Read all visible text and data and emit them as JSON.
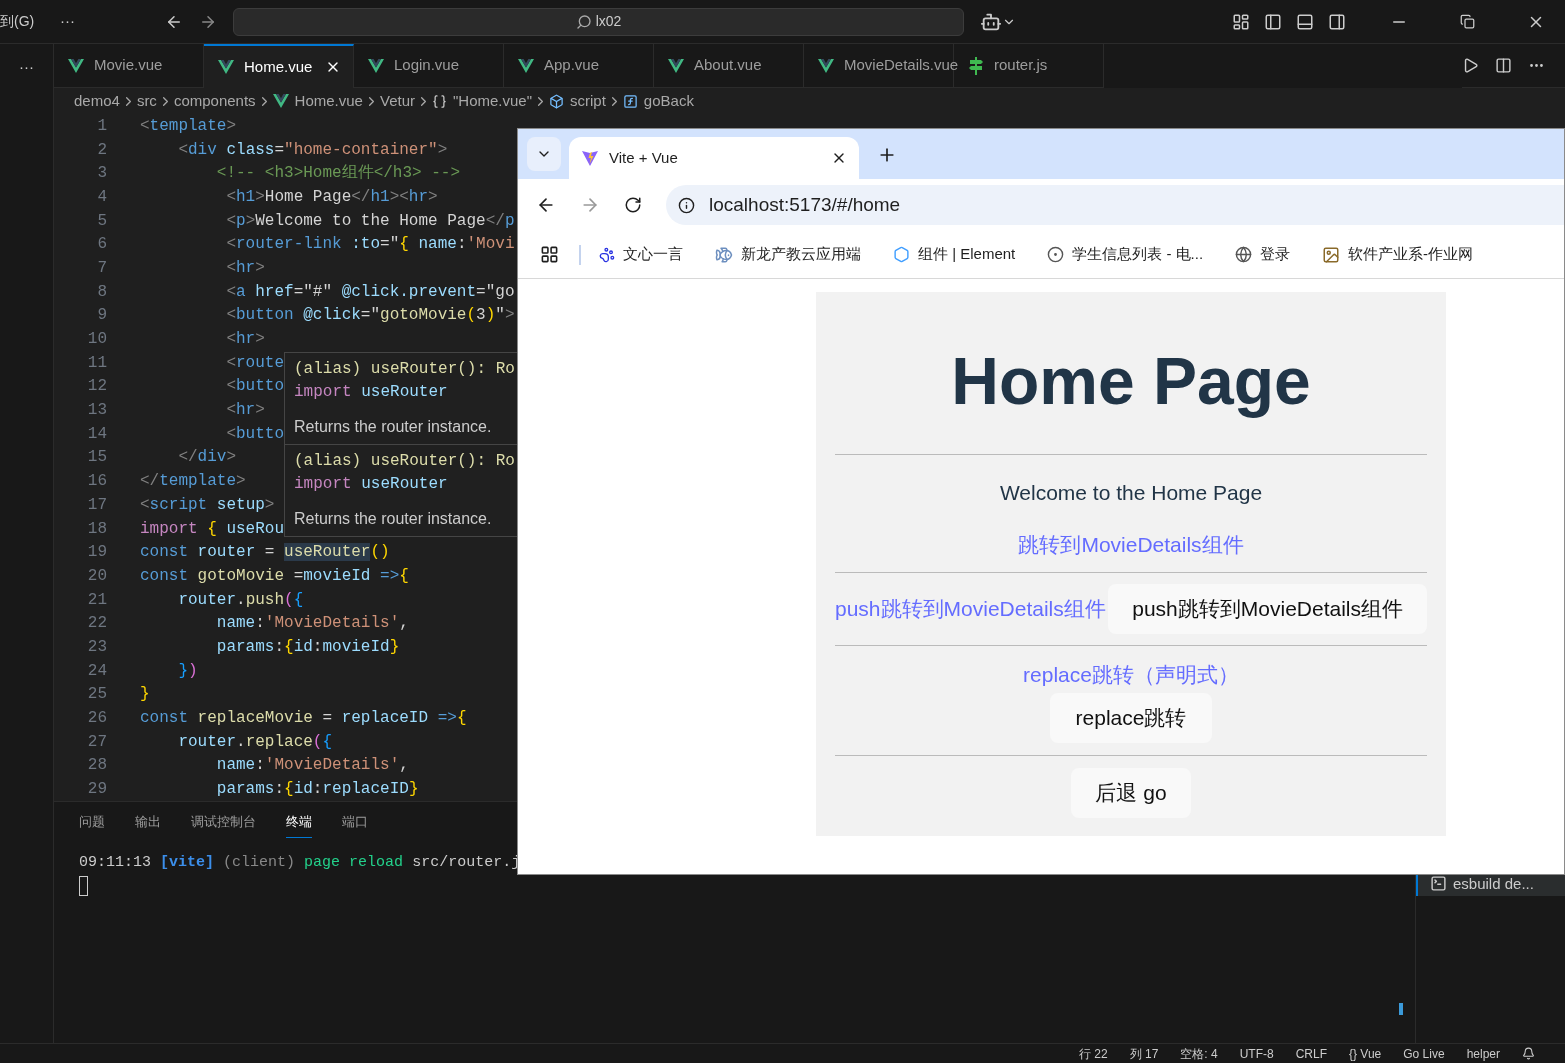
{
  "title_bar": {
    "menu_fragment": "到(G)",
    "more": "···",
    "search": "lx02"
  },
  "activity_bar": {
    "more": "···"
  },
  "tabs": [
    {
      "label": "Movie.vue",
      "kind": "vue",
      "selected": false
    },
    {
      "label": "Home.vue",
      "kind": "vue",
      "selected": true
    },
    {
      "label": "Login.vue",
      "kind": "vue",
      "selected": false
    },
    {
      "label": "App.vue",
      "kind": "vue",
      "selected": false
    },
    {
      "label": "About.vue",
      "kind": "vue",
      "selected": false
    },
    {
      "label": "MovieDetails.vue",
      "kind": "vue",
      "selected": false
    },
    {
      "label": "router.js",
      "kind": "js",
      "selected": false
    }
  ],
  "breadcrumb": [
    {
      "label": "demo4",
      "kind": "folder"
    },
    {
      "label": "src",
      "kind": "folder"
    },
    {
      "label": "components",
      "kind": "folder"
    },
    {
      "label": "Home.vue",
      "kind": "vue"
    },
    {
      "label": "Vetur",
      "kind": "folder"
    },
    {
      "label": "\"Home.vue\"",
      "kind": "braces"
    },
    {
      "label": "script",
      "kind": "module"
    },
    {
      "label": "goBack",
      "kind": "symbol"
    }
  ],
  "editor": {
    "lines": [
      {
        "number": "1",
        "tokens": [
          {
            "kind": "punct",
            "text": "<"
          },
          {
            "kind": "tag",
            "text": "template"
          },
          {
            "kind": "punct",
            "text": ">"
          }
        ]
      },
      {
        "number": "2",
        "tokens": [
          {
            "kind": "punct",
            "text": "    <"
          },
          {
            "kind": "tag",
            "text": "div"
          },
          {
            "kind": "attr",
            "text": " class"
          },
          {
            "kind": "text",
            "text": "="
          },
          {
            "kind": "string",
            "text": "\"home-container\""
          },
          {
            "kind": "punct",
            "text": ">"
          }
        ]
      },
      {
        "number": "3",
        "tokens": [
          {
            "kind": "comment",
            "text": "        <!-- <h3>Home组件</h3> -->"
          }
        ]
      },
      {
        "number": "4",
        "tokens": [
          {
            "kind": "punct",
            "text": "         <"
          },
          {
            "kind": "tag",
            "text": "h1"
          },
          {
            "kind": "punct",
            "text": ">"
          },
          {
            "kind": "text",
            "text": "Home Page"
          },
          {
            "kind": "punct",
            "text": "</"
          },
          {
            "kind": "tag",
            "text": "h1"
          },
          {
            "kind": "punct",
            "text": "><"
          },
          {
            "kind": "tag",
            "text": "hr"
          },
          {
            "kind": "punct",
            "text": ">"
          }
        ]
      },
      {
        "number": "5",
        "tokens": [
          {
            "kind": "punct",
            "text": "         <"
          },
          {
            "kind": "tag",
            "text": "p"
          },
          {
            "kind": "punct",
            "text": ">"
          },
          {
            "kind": "text",
            "text": "Welcome to the Home Page"
          },
          {
            "kind": "punct",
            "text": "</"
          },
          {
            "kind": "tag",
            "text": "p"
          }
        ]
      },
      {
        "number": "6",
        "tokens": [
          {
            "kind": "punct",
            "text": "         <"
          },
          {
            "kind": "tag",
            "text": "router-link"
          },
          {
            "kind": "attr",
            "text": " :to"
          },
          {
            "kind": "text",
            "text": "=\""
          },
          {
            "kind": "bracket1",
            "text": "{"
          },
          {
            "kind": "attr",
            "text": " name"
          },
          {
            "kind": "text",
            "text": ":"
          },
          {
            "kind": "string",
            "text": "'Movi"
          }
        ]
      },
      {
        "number": "7",
        "tokens": [
          {
            "kind": "punct",
            "text": "         <"
          },
          {
            "kind": "tag",
            "text": "hr"
          },
          {
            "kind": "punct",
            "text": ">"
          }
        ]
      },
      {
        "number": "8",
        "tokens": [
          {
            "kind": "punct",
            "text": "         <"
          },
          {
            "kind": "tag",
            "text": "a"
          },
          {
            "kind": "attr",
            "text": " href"
          },
          {
            "kind": "text",
            "text": "=\"#\""
          },
          {
            "kind": "attr",
            "text": " @click.prevent"
          },
          {
            "kind": "text",
            "text": "=\"go"
          }
        ]
      },
      {
        "number": "9",
        "tokens": [
          {
            "kind": "punct",
            "text": "         <"
          },
          {
            "kind": "tag",
            "text": "button"
          },
          {
            "kind": "attr",
            "text": " @click"
          },
          {
            "kind": "text",
            "text": "=\""
          },
          {
            "kind": "function",
            "text": "gotoMovie"
          },
          {
            "kind": "bracket1",
            "text": "("
          },
          {
            "kind": "text",
            "text": "3"
          },
          {
            "kind": "bracket1",
            "text": ")"
          },
          {
            "kind": "text",
            "text": "\""
          },
          {
            "kind": "punct",
            "text": ">"
          }
        ]
      },
      {
        "number": "10",
        "tokens": [
          {
            "kind": "punct",
            "text": "         <"
          },
          {
            "kind": "tag",
            "text": "hr"
          },
          {
            "kind": "punct",
            "text": ">"
          }
        ]
      },
      {
        "number": "11",
        "tokens": [
          {
            "kind": "punct",
            "text": "         <"
          },
          {
            "kind": "tag",
            "text": "route"
          }
        ]
      },
      {
        "number": "12",
        "tokens": [
          {
            "kind": "punct",
            "text": "         <"
          },
          {
            "kind": "tag",
            "text": "butto"
          }
        ]
      },
      {
        "number": "13",
        "tokens": [
          {
            "kind": "punct",
            "text": "         <"
          },
          {
            "kind": "tag",
            "text": "hr"
          },
          {
            "kind": "punct",
            "text": ">"
          }
        ]
      },
      {
        "number": "14",
        "tokens": [
          {
            "kind": "punct",
            "text": "         <"
          },
          {
            "kind": "tag",
            "text": "butto"
          }
        ]
      },
      {
        "number": "15",
        "tokens": [
          {
            "kind": "punct",
            "text": "    </"
          },
          {
            "kind": "tag",
            "text": "div"
          },
          {
            "kind": "punct",
            "text": ">"
          }
        ]
      },
      {
        "number": "16",
        "tokens": [
          {
            "kind": "punct",
            "text": "</"
          },
          {
            "kind": "tag",
            "text": "template"
          },
          {
            "kind": "punct",
            "text": ">"
          }
        ]
      },
      {
        "number": "17",
        "tokens": [
          {
            "kind": "punct",
            "text": "<"
          },
          {
            "kind": "tag",
            "text": "script"
          },
          {
            "kind": "attr",
            "text": " setup"
          },
          {
            "kind": "punct",
            "text": ">"
          }
        ]
      },
      {
        "number": "18",
        "tokens": [
          {
            "kind": "keyword",
            "text": "import"
          },
          {
            "kind": "bracket1",
            "text": " {"
          },
          {
            "kind": "variable",
            "text": " useRou"
          }
        ]
      },
      {
        "number": "19",
        "tokens": [
          {
            "kind": "storage",
            "text": "const"
          },
          {
            "kind": "variable",
            "text": " router"
          },
          {
            "kind": "text",
            "text": " = "
          },
          {
            "kind": "match",
            "text": "useRouter"
          },
          {
            "kind": "bracket1",
            "text": "()"
          }
        ]
      },
      {
        "number": "20",
        "tokens": [
          {
            "kind": "storage",
            "text": "const"
          },
          {
            "kind": "function",
            "text": " gotoMovie"
          },
          {
            "kind": "text",
            "text": " ="
          },
          {
            "kind": "variable",
            "text": "movieId"
          },
          {
            "kind": "storage",
            "text": " =>"
          },
          {
            "kind": "bracket1",
            "text": "{"
          }
        ]
      },
      {
        "number": "21",
        "tokens": [
          {
            "kind": "variable",
            "text": "    router"
          },
          {
            "kind": "text",
            "text": "."
          },
          {
            "kind": "function",
            "text": "push"
          },
          {
            "kind": "bracket2",
            "text": "("
          },
          {
            "kind": "bracket3",
            "text": "{"
          }
        ]
      },
      {
        "number": "22",
        "tokens": [
          {
            "kind": "variable",
            "text": "        name"
          },
          {
            "kind": "text",
            "text": ":"
          },
          {
            "kind": "string",
            "text": "'MovieDetails'"
          },
          {
            "kind": "text",
            "text": ","
          }
        ]
      },
      {
        "number": "23",
        "tokens": [
          {
            "kind": "variable",
            "text": "        params"
          },
          {
            "kind": "text",
            "text": ":"
          },
          {
            "kind": "bracket1",
            "text": "{"
          },
          {
            "kind": "variable",
            "text": "id"
          },
          {
            "kind": "text",
            "text": ":"
          },
          {
            "kind": "variable",
            "text": "movieId"
          },
          {
            "kind": "bracket1",
            "text": "}"
          }
        ]
      },
      {
        "number": "24",
        "tokens": [
          {
            "kind": "bracket3",
            "text": "    }"
          },
          {
            "kind": "bracket2",
            "text": ")"
          }
        ]
      },
      {
        "number": "25",
        "tokens": [
          {
            "kind": "bracket1",
            "text": "}"
          }
        ]
      },
      {
        "number": "26",
        "tokens": [
          {
            "kind": "storage",
            "text": "const"
          },
          {
            "kind": "function",
            "text": " replaceMovie"
          },
          {
            "kind": "text",
            "text": " = "
          },
          {
            "kind": "variable",
            "text": "replaceID"
          },
          {
            "kind": "storage",
            "text": " =>"
          },
          {
            "kind": "bracket1",
            "text": "{"
          }
        ]
      },
      {
        "number": "27",
        "tokens": [
          {
            "kind": "variable",
            "text": "    router"
          },
          {
            "kind": "text",
            "text": "."
          },
          {
            "kind": "function",
            "text": "replace"
          },
          {
            "kind": "bracket2",
            "text": "("
          },
          {
            "kind": "bracket3",
            "text": "{"
          }
        ]
      },
      {
        "number": "28",
        "tokens": [
          {
            "kind": "variable",
            "text": "        name"
          },
          {
            "kind": "text",
            "text": ":"
          },
          {
            "kind": "string",
            "text": "'MovieDetails'"
          },
          {
            "kind": "text",
            "text": ","
          }
        ]
      },
      {
        "number": "29",
        "tokens": [
          {
            "kind": "variable",
            "text": "        params"
          },
          {
            "kind": "text",
            "text": ":"
          },
          {
            "kind": "bracket1",
            "text": "{"
          },
          {
            "kind": "variable",
            "text": "id"
          },
          {
            "kind": "text",
            "text": ":"
          },
          {
            "kind": "variable",
            "text": "replaceID"
          },
          {
            "kind": "bracket1",
            "text": "}"
          }
        ]
      }
    ]
  },
  "hover": {
    "sections": [
      {
        "signature": "(alias) useRouter(): Ro",
        "import_keyword": "import",
        "import_name": "useRouter",
        "doc": "Returns the router instance."
      },
      {
        "signature": "(alias) useRouter(): Ro",
        "import_keyword": "import",
        "import_name": "useRouter",
        "doc": "Returns the router instance."
      }
    ]
  },
  "panel": {
    "tabs": [
      {
        "label": "问题",
        "selected": false
      },
      {
        "label": "输出",
        "selected": false
      },
      {
        "label": "调试控制台",
        "selected": false
      },
      {
        "label": "终端",
        "selected": true
      },
      {
        "label": "端口",
        "selected": false
      }
    ],
    "terminal_line": {
      "time": "09:11:13",
      "tag": "[vite]",
      "source": "(client)",
      "event": "page reload",
      "path": "src/router.j"
    },
    "terminals": [
      {
        "label": "esbuild de...",
        "selected": true
      }
    ]
  },
  "status_bar": [
    "行 22",
    "列 17",
    "空格: 4",
    "UTF-8",
    "CRLF",
    "{} Vue",
    "Go Live",
    "helper"
  ],
  "browser": {
    "tab_title": "Vite + Vue",
    "url": "localhost:5173/#/home",
    "bookmarks": [
      {
        "label": "文心一言",
        "kind": "paw"
      },
      {
        "label": "新龙产教云应用端",
        "kind": "fish"
      },
      {
        "label": "组件 | Element",
        "kind": "hex"
      },
      {
        "label": "学生信息列表 - 电...",
        "kind": "circle"
      },
      {
        "label": "登录",
        "kind": "globe"
      },
      {
        "label": "软件产业系-作业网",
        "kind": "image"
      }
    ],
    "page": {
      "heading": "Home Page",
      "welcome": "Welcome to the Home Page",
      "link_1": "跳转到MovieDetails组件",
      "push_link": "push跳转到MovieDetails组件",
      "push_button": "push跳转到MovieDetails组件",
      "replace_link": "replace跳转（声明式）",
      "replace_button": "replace跳转",
      "back_button": "后退 go"
    }
  }
}
